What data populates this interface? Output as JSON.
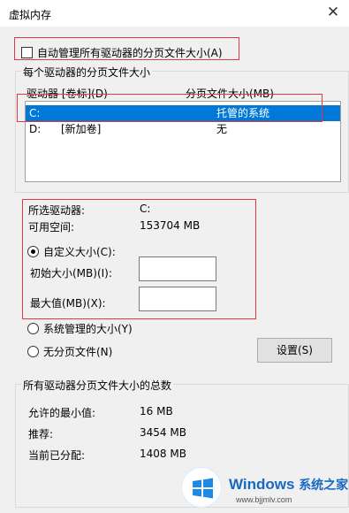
{
  "window": {
    "title": "虚拟内存",
    "close_glyph": "✕"
  },
  "auto_manage": {
    "label": "自动管理所有驱动器的分页文件大小(A)",
    "checked": false
  },
  "per_drive": {
    "group_label": "每个驱动器的分页文件大小",
    "col_drive": "驱动器 [卷标](D)",
    "col_size": "分页文件大小(MB)",
    "rows": [
      {
        "drive": "C:",
        "label": "",
        "size": "托管的系统",
        "selected": true
      },
      {
        "drive": "D:",
        "label": "[新加卷]",
        "size": "无",
        "selected": false
      }
    ]
  },
  "selected_drive": {
    "drive_label": "所选驱动器:",
    "drive_value": "C:",
    "space_label": "可用空间:",
    "space_value": "153704 MB",
    "custom_label": "自定义大小(C):",
    "initial_label": "初始大小(MB)(I):",
    "initial_value": "",
    "max_label": "最大值(MB)(X):",
    "max_value": "",
    "system_managed_label": "系统管理的大小(Y)",
    "no_paging_label": "无分页文件(N)",
    "set_button": "设置(S)"
  },
  "totals": {
    "group_label": "所有驱动器分页文件大小的总数",
    "min_label": "允许的最小值:",
    "min_value": "16 MB",
    "recommended_label": "推荐:",
    "recommended_value": "3454 MB",
    "current_label": "当前已分配:",
    "current_value": "1408 MB"
  },
  "watermark": {
    "brand": "Windows",
    "brand_cn": "系统之家",
    "url": "www.bjjmlv.com"
  },
  "colors": {
    "accent": "#0078d7",
    "highlight_box": "#e0393e",
    "dialog_bg": "#f0f0f0"
  }
}
